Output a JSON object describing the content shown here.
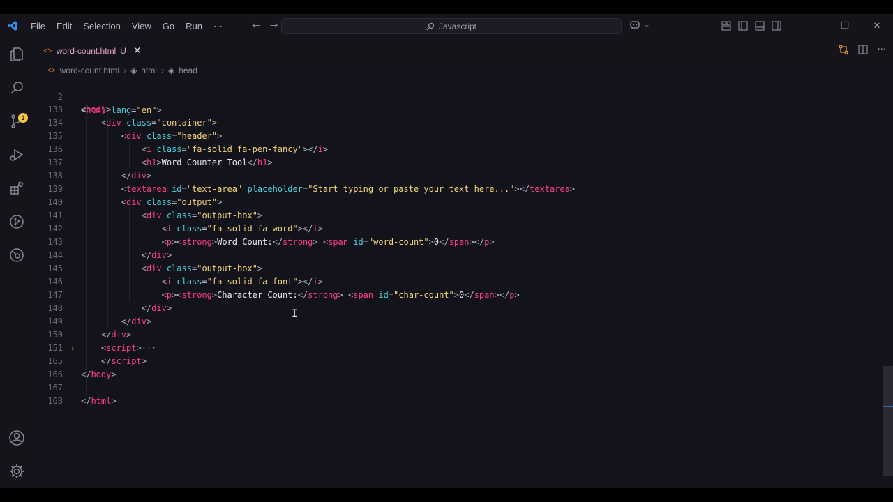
{
  "menu": [
    "File",
    "Edit",
    "Selection",
    "View",
    "Go",
    "Run",
    "···"
  ],
  "command_center": {
    "text": "Javascript"
  },
  "tab": {
    "filename": "word-count.html",
    "status": "U",
    "close": "✕"
  },
  "breadcrumb": [
    "word-count.html",
    "html",
    "head"
  ],
  "activity_badge": "1",
  "editor": {
    "sticky": {
      "num": "2",
      "code": "<html lang=\"en\">"
    },
    "lines": [
      {
        "num": "133",
        "html": "<span class='p'>&lt;</span><span class='t'>body</span><span class='p'>&gt;</span>"
      },
      {
        "num": "134",
        "html": "    <span class='p'>&lt;</span><span class='t'>div</span> <span class='a'>class</span><span class='p'>=</span><span class='s'>\"container\"</span><span class='p'>&gt;</span>"
      },
      {
        "num": "135",
        "html": "        <span class='p'>&lt;</span><span class='t'>div</span> <span class='a'>class</span><span class='p'>=</span><span class='s'>\"header\"</span><span class='p'>&gt;</span>"
      },
      {
        "num": "136",
        "html": "            <span class='p'>&lt;</span><span class='t'>i</span> <span class='a'>class</span><span class='p'>=</span><span class='s'>\"fa-solid fa-pen-fancy\"</span><span class='p'>&gt;&lt;/</span><span class='t'>i</span><span class='p'>&gt;</span>"
      },
      {
        "num": "137",
        "html": "            <span class='p'>&lt;</span><span class='t'>h1</span><span class='p'>&gt;</span><span class='x'>Word Counter Tool</span><span class='p'>&lt;/</span><span class='t'>h1</span><span class='p'>&gt;</span>"
      },
      {
        "num": "138",
        "html": "        <span class='p'>&lt;/</span><span class='t'>div</span><span class='p'>&gt;</span>"
      },
      {
        "num": "139",
        "html": "        <span class='p'>&lt;</span><span class='t'>textarea</span> <span class='a'>id</span><span class='p'>=</span><span class='s'>\"text-area\"</span> <span class='a'>placeholder</span><span class='p'>=</span><span class='s'>\"Start typing or paste your text here...\"</span><span class='p'>&gt;&lt;/</span><span class='t'>textarea</span><span class='p'>&gt;</span>"
      },
      {
        "num": "140",
        "html": "        <span class='p'>&lt;</span><span class='t'>div</span> <span class='a'>class</span><span class='p'>=</span><span class='s'>\"output\"</span><span class='p'>&gt;</span>"
      },
      {
        "num": "141",
        "html": "            <span class='p'>&lt;</span><span class='t'>div</span> <span class='a'>class</span><span class='p'>=</span><span class='s'>\"output-box\"</span><span class='p'>&gt;</span>"
      },
      {
        "num": "142",
        "html": "                <span class='p'>&lt;</span><span class='t'>i</span> <span class='a'>class</span><span class='p'>=</span><span class='s'>\"fa-solid fa-word\"</span><span class='p'>&gt;&lt;/</span><span class='t'>i</span><span class='p'>&gt;</span>"
      },
      {
        "num": "143",
        "html": "                <span class='p'>&lt;</span><span class='t'>p</span><span class='p'>&gt;&lt;</span><span class='t'>strong</span><span class='p'>&gt;</span><span class='x'>Word Count:</span><span class='p'>&lt;/</span><span class='t'>strong</span><span class='p'>&gt;</span> <span class='p'>&lt;</span><span class='t'>span</span> <span class='a'>id</span><span class='p'>=</span><span class='s'>\"word-count\"</span><span class='p'>&gt;</span><span class='x'>0</span><span class='p'>&lt;/</span><span class='t'>span</span><span class='p'>&gt;&lt;/</span><span class='t'>p</span><span class='p'>&gt;</span>"
      },
      {
        "num": "144",
        "html": "            <span class='p'>&lt;/</span><span class='t'>div</span><span class='p'>&gt;</span>"
      },
      {
        "num": "145",
        "html": "            <span class='p'>&lt;</span><span class='t'>div</span> <span class='a'>class</span><span class='p'>=</span><span class='s'>\"output-box\"</span><span class='p'>&gt;</span>"
      },
      {
        "num": "146",
        "html": "                <span class='p'>&lt;</span><span class='t'>i</span> <span class='a'>class</span><span class='p'>=</span><span class='s'>\"fa-solid fa-font\"</span><span class='p'>&gt;&lt;/</span><span class='t'>i</span><span class='p'>&gt;</span>"
      },
      {
        "num": "147",
        "html": "                <span class='p'>&lt;</span><span class='t'>p</span><span class='p'>&gt;&lt;</span><span class='t'>strong</span><span class='p'>&gt;</span><span class='x'>Character Count:</span><span class='p'>&lt;/</span><span class='t'>strong</span><span class='p'>&gt;</span> <span class='p'>&lt;</span><span class='t'>span</span> <span class='a'>id</span><span class='p'>=</span><span class='s'>\"char-count\"</span><span class='p'>&gt;</span><span class='x'>0</span><span class='p'>&lt;/</span><span class='t'>span</span><span class='p'>&gt;&lt;/</span><span class='t'>p</span><span class='p'>&gt;</span>"
      },
      {
        "num": "148",
        "html": "            <span class='p'>&lt;/</span><span class='t'>div</span><span class='p'>&gt;</span>"
      },
      {
        "num": "149",
        "html": "        <span class='p'>&lt;/</span><span class='t'>div</span><span class='p'>&gt;</span>"
      },
      {
        "num": "150",
        "html": "    <span class='p'>&lt;/</span><span class='t'>div</span><span class='p'>&gt;</span>"
      },
      {
        "num": "151",
        "html": "    <span class='p'>&lt;</span><span class='t'>script</span><span class='p'>&gt;</span><span class='g'>···</span>",
        "folded": true
      },
      {
        "num": "165",
        "html": "    <span class='p'>&lt;/</span><span class='t'>script</span><span class='p'>&gt;</span>"
      },
      {
        "num": "166",
        "html": "<span class='p'>&lt;/</span><span class='t'>body</span><span class='p'>&gt;</span>"
      },
      {
        "num": "167",
        "html": ""
      },
      {
        "num": "168",
        "html": "<span class='p'>&lt;/</span><span class='t'>html</span><span class='p'>&gt;</span>"
      }
    ]
  },
  "colors": {
    "tag": "#ff3e82",
    "attr": "#4ecfd9",
    "string": "#f3d479",
    "text": "#e9e9ee",
    "punct": "#b3b3bd",
    "bg": "#13131b"
  }
}
